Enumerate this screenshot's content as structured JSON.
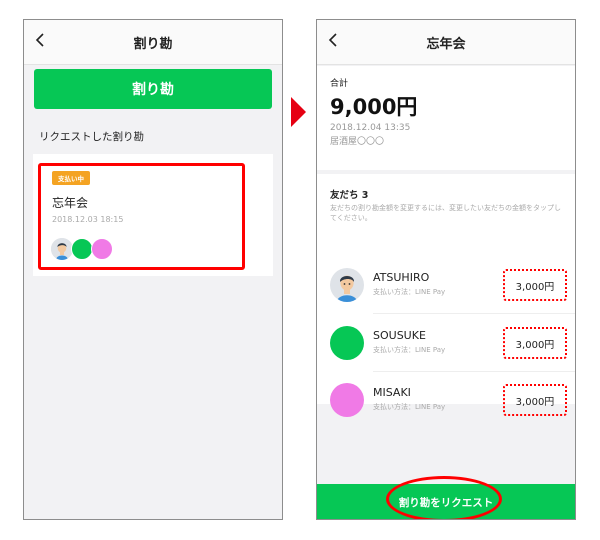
{
  "left_screen": {
    "nav_title": "割り勘",
    "primary_button": "割り勘",
    "section_label": "リクエストした割り勘",
    "card": {
      "badge": "支払い中",
      "title": "忘年会",
      "date": "2018.12.03 18:15"
    }
  },
  "right_screen": {
    "nav_title": "忘年会",
    "total_label": "合計",
    "amount": "9,000円",
    "date": "2018.12.04 13:35",
    "place": "居酒屋〇〇〇",
    "friends_title": "友だち 3",
    "friends_desc": "友だちの割り勘金額を変更するには、変更したい友だちの金額をタップしてください。",
    "friends": [
      {
        "name": "ATSUHIRO",
        "pay_method": "支払い方法：LINE Pay",
        "amount": "3,000円",
        "avatar": "person-avatar"
      },
      {
        "name": "SOUSUKE",
        "pay_method": "支払い方法：LINE Pay",
        "amount": "3,000円",
        "avatar": "green-circle",
        "color": "#06c755"
      },
      {
        "name": "MISAKI",
        "pay_method": "支払い方法：LINE Pay",
        "amount": "3,000円",
        "avatar": "pink-circle",
        "color": "#f07ae6"
      }
    ],
    "request_button": "割り勘をリクエスト"
  },
  "colors": {
    "line_green": "#06c755",
    "badge_orange": "#f4a322",
    "highlight_red": "#ff0000",
    "arrow_red": "#e60012",
    "pink": "#f07ae6"
  }
}
